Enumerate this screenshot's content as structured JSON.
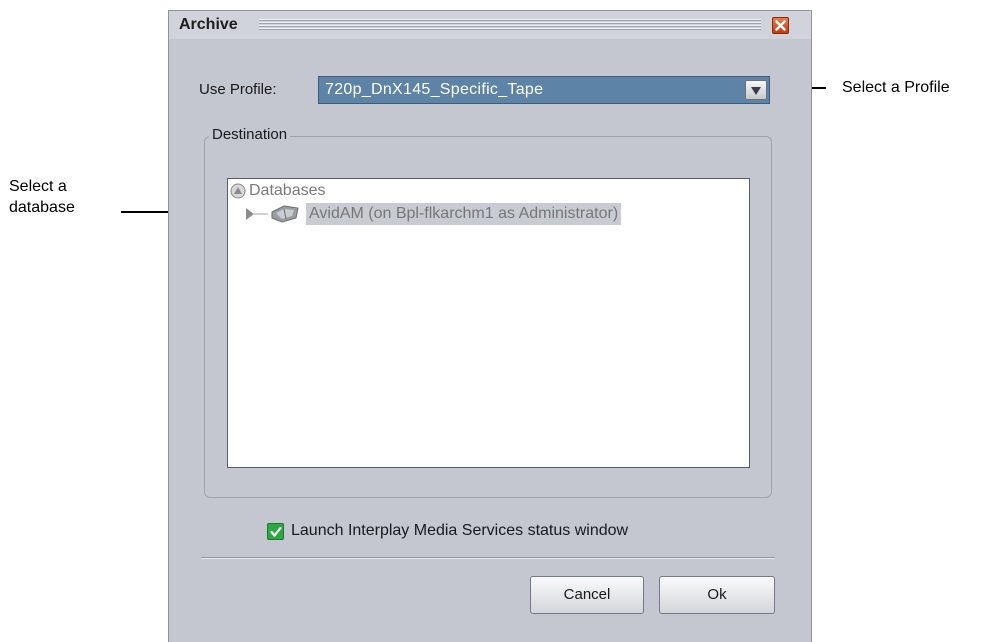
{
  "dialog": {
    "title": "Archive",
    "close_icon": "close-icon"
  },
  "profile": {
    "label": "Use Profile:",
    "value": "720p_DnX145_Specific_Tape"
  },
  "destination": {
    "legend": "Destination",
    "tree": {
      "root_label": "Databases",
      "items": [
        {
          "label": "AvidAM (on Bpl-flkarchm1 as Administrator)",
          "selected": true,
          "expanded": false
        }
      ]
    }
  },
  "launch_option": {
    "label": "Launch Interplay Media Services status window",
    "checked": true
  },
  "buttons": {
    "cancel": "Cancel",
    "ok": "Ok"
  },
  "callouts": {
    "profile": "Select a Profile",
    "database_line1": "Select a",
    "database_line2": "database"
  },
  "colors": {
    "dialog_bg": "#c4c7d0",
    "selected_profile_bg": "#5d83a6",
    "checkbox_green": "#2fa844",
    "close_red": "#d9521e"
  }
}
